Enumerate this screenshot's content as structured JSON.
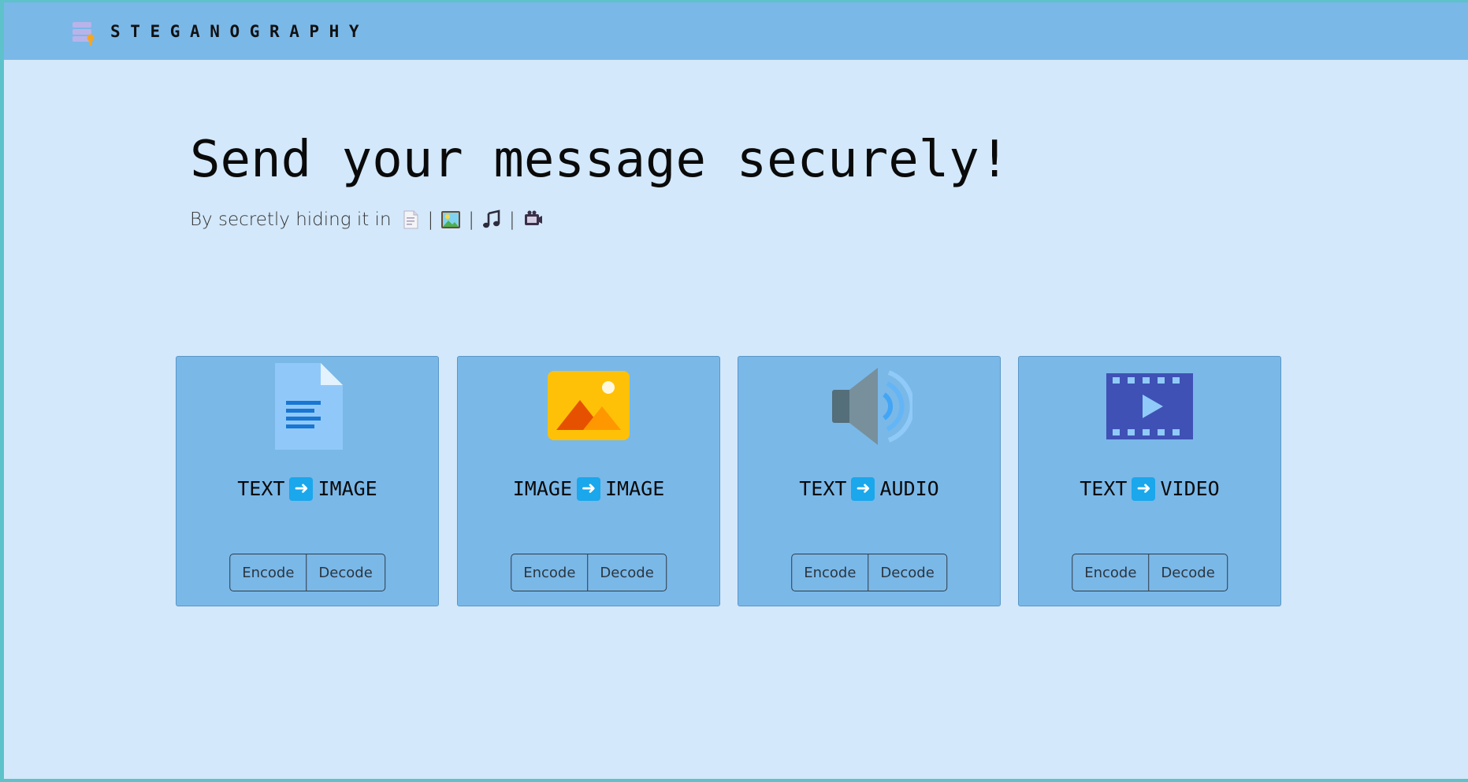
{
  "navbar": {
    "brand_title": "STEGANOGRAPHY",
    "brand_icon": "database-key-icon"
  },
  "hero": {
    "title": "Send your message securely!",
    "subtitle_lead": "By secretly hiding it in",
    "separator": "|",
    "media_icons": [
      "document-icon",
      "picture-icon",
      "music-notes-icon",
      "video-camera-icon"
    ]
  },
  "cards": [
    {
      "from": "TEXT",
      "to": "IMAGE",
      "icon": "document-icon",
      "encode_label": "Encode",
      "decode_label": "Decode"
    },
    {
      "from": "IMAGE",
      "to": "IMAGE",
      "icon": "image-icon",
      "encode_label": "Encode",
      "decode_label": "Decode"
    },
    {
      "from": "TEXT",
      "to": "AUDIO",
      "icon": "speaker-icon",
      "encode_label": "Encode",
      "decode_label": "Decode"
    },
    {
      "from": "TEXT",
      "to": "VIDEO",
      "icon": "film-icon",
      "encode_label": "Encode",
      "decode_label": "Decode"
    }
  ],
  "colors": {
    "page_background": "#d3e8fa",
    "navbar": "#7ab8e8",
    "card": "#7ab8e8",
    "arrow_accent": "#1aa7ec"
  }
}
